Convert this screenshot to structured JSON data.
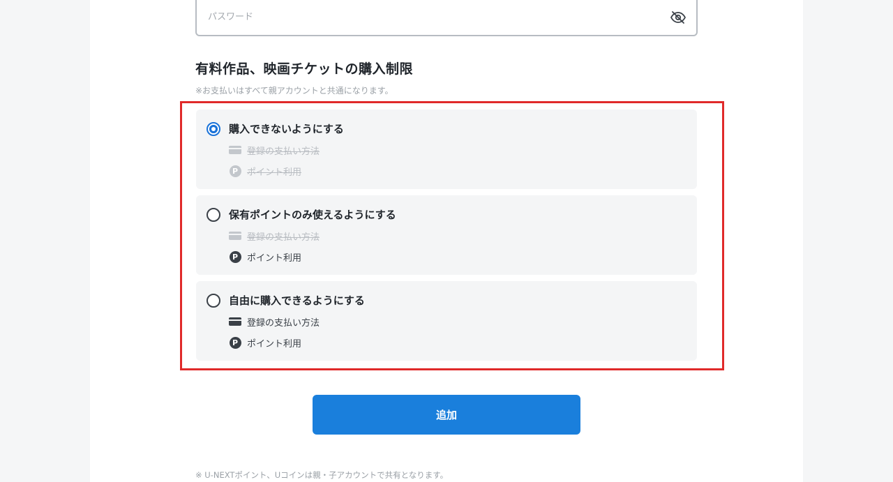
{
  "password": {
    "placeholder": "パスワード",
    "value": ""
  },
  "purchase_limit": {
    "title": "有料作品、映画チケットの購入制限",
    "note": "※お支払いはすべて親アカウントと共通になります。",
    "options": [
      {
        "label": "購入できないようにする",
        "selected": true,
        "payment_method": "登録の支払い方法",
        "points": "ポイント利用"
      },
      {
        "label": "保有ポイントのみ使えるようにする",
        "selected": false,
        "payment_method": "登録の支払い方法",
        "points": "ポイント利用"
      },
      {
        "label": "自由に購入できるようにする",
        "selected": false,
        "payment_method": "登録の支払い方法",
        "points": "ポイント利用"
      }
    ],
    "point_icon_letter": "P"
  },
  "submit": {
    "label": "追加"
  },
  "footnote": "※ U-NEXTポイント、Uコインは親・子アカウントで共有となります。",
  "colors": {
    "accent": "#1a7fdc",
    "highlight_border": "#e02a2a"
  }
}
